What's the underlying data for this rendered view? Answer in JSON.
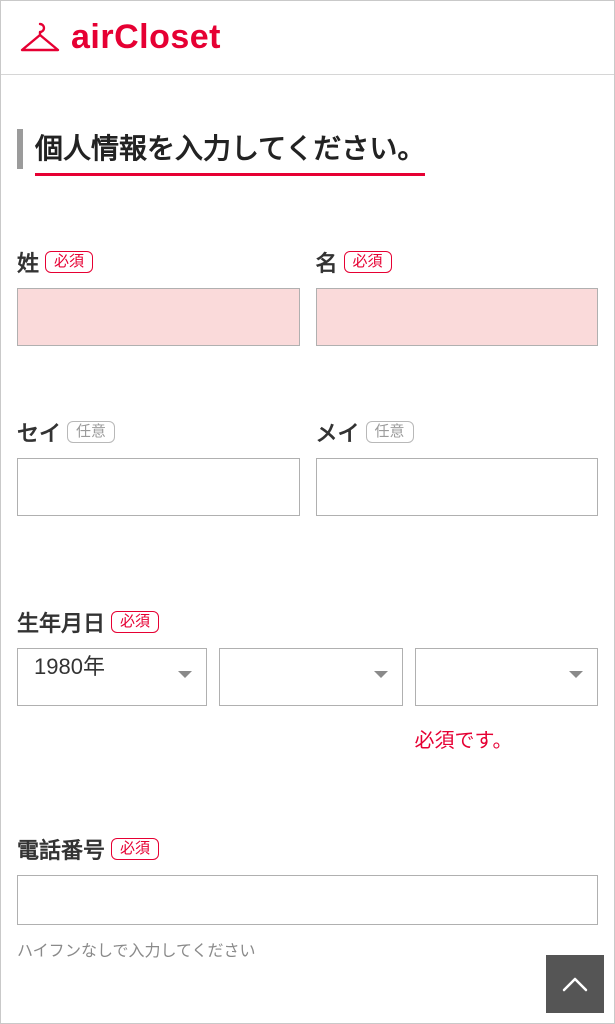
{
  "brand": {
    "name": "airCloset"
  },
  "page_title": "個人情報を入力してください。",
  "badges": {
    "required": "必須",
    "optional": "任意"
  },
  "fields": {
    "last_name": {
      "label": "姓",
      "value": "",
      "required": true,
      "error": true
    },
    "first_name": {
      "label": "名",
      "value": "",
      "required": true,
      "error": true
    },
    "last_name_kana": {
      "label": "セイ",
      "value": "",
      "required": false
    },
    "first_name_kana": {
      "label": "メイ",
      "value": "",
      "required": false
    },
    "birthdate": {
      "label": "生年月日",
      "required": true,
      "year": {
        "selected": "1980年"
      },
      "month": {
        "selected": ""
      },
      "day": {
        "selected": "",
        "error_message": "必須です。"
      }
    },
    "phone": {
      "label": "電話番号",
      "required": true,
      "value": "",
      "helper": "ハイフンなしで入力してください"
    }
  }
}
